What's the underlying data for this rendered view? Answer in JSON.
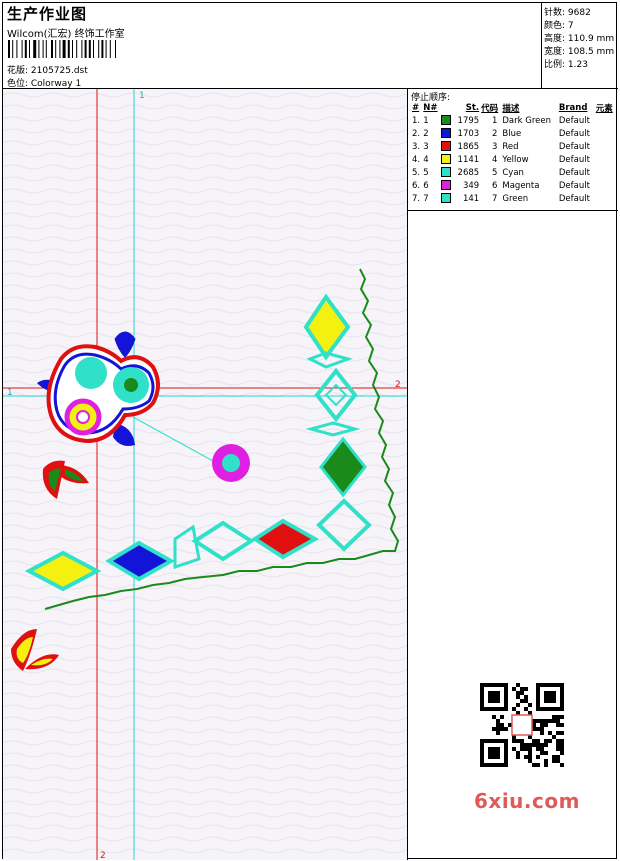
{
  "header": {
    "title": "生产作业图",
    "company": "Wilcom(汇宏) 终饰工作室",
    "design_line": "花版: 2105725.dst",
    "colorway_line": "色位: Colorway 1"
  },
  "stats": [
    {
      "label": "针数:",
      "value": "9682"
    },
    {
      "label": "颜色:",
      "value": "7"
    },
    {
      "label": "高度:",
      "value": "110.9 mm"
    },
    {
      "label": "宽度:",
      "value": "108.5 mm"
    },
    {
      "label": "比例:",
      "value": "1.23"
    }
  ],
  "stop_sequence": {
    "title": "停止顺序:",
    "headers": [
      "#",
      "N#",
      "St.",
      "代码",
      "描述",
      "Brand",
      "元素"
    ],
    "rows": [
      {
        "num": "1.",
        "n": "1",
        "color": "#1a8a1a",
        "st": "1795",
        "code": "1",
        "desc": "Dark Green",
        "brand": "Default",
        "elem": ""
      },
      {
        "num": "2.",
        "n": "2",
        "color": "#1414d8",
        "st": "1703",
        "code": "2",
        "desc": "Blue",
        "brand": "Default",
        "elem": ""
      },
      {
        "num": "3.",
        "n": "3",
        "color": "#e01010",
        "st": "1865",
        "code": "3",
        "desc": "Red",
        "brand": "Default",
        "elem": ""
      },
      {
        "num": "4.",
        "n": "4",
        "color": "#f4f010",
        "st": "1141",
        "code": "4",
        "desc": "Yellow",
        "brand": "Default",
        "elem": ""
      },
      {
        "num": "5.",
        "n": "5",
        "color": "#30e0c8",
        "st": "2685",
        "code": "5",
        "desc": "Cyan",
        "brand": "Default",
        "elem": ""
      },
      {
        "num": "6.",
        "n": "6",
        "color": "#e020e0",
        "st": "349",
        "code": "6",
        "desc": "Magenta",
        "brand": "Default",
        "elem": ""
      },
      {
        "num": "7.",
        "n": "7",
        "color": "#30e0c8",
        "st": "141",
        "code": "7",
        "desc": "Green",
        "brand": "Default",
        "elem": ""
      }
    ]
  },
  "guides": {
    "red_label_top": "1",
    "red_label_bottom": "2",
    "h_label_left": "1",
    "h_label_right": "2",
    "cyan_label_top": "1"
  },
  "watermark": "6xiu.com",
  "colors": {
    "dark_green": "#1a8a1a",
    "blue": "#1414d8",
    "red": "#e01010",
    "yellow": "#f4f010",
    "cyan": "#30e0c8",
    "magenta": "#e020e0",
    "guide_red": "#e01010",
    "guide_cyan": "#22d6d6"
  }
}
